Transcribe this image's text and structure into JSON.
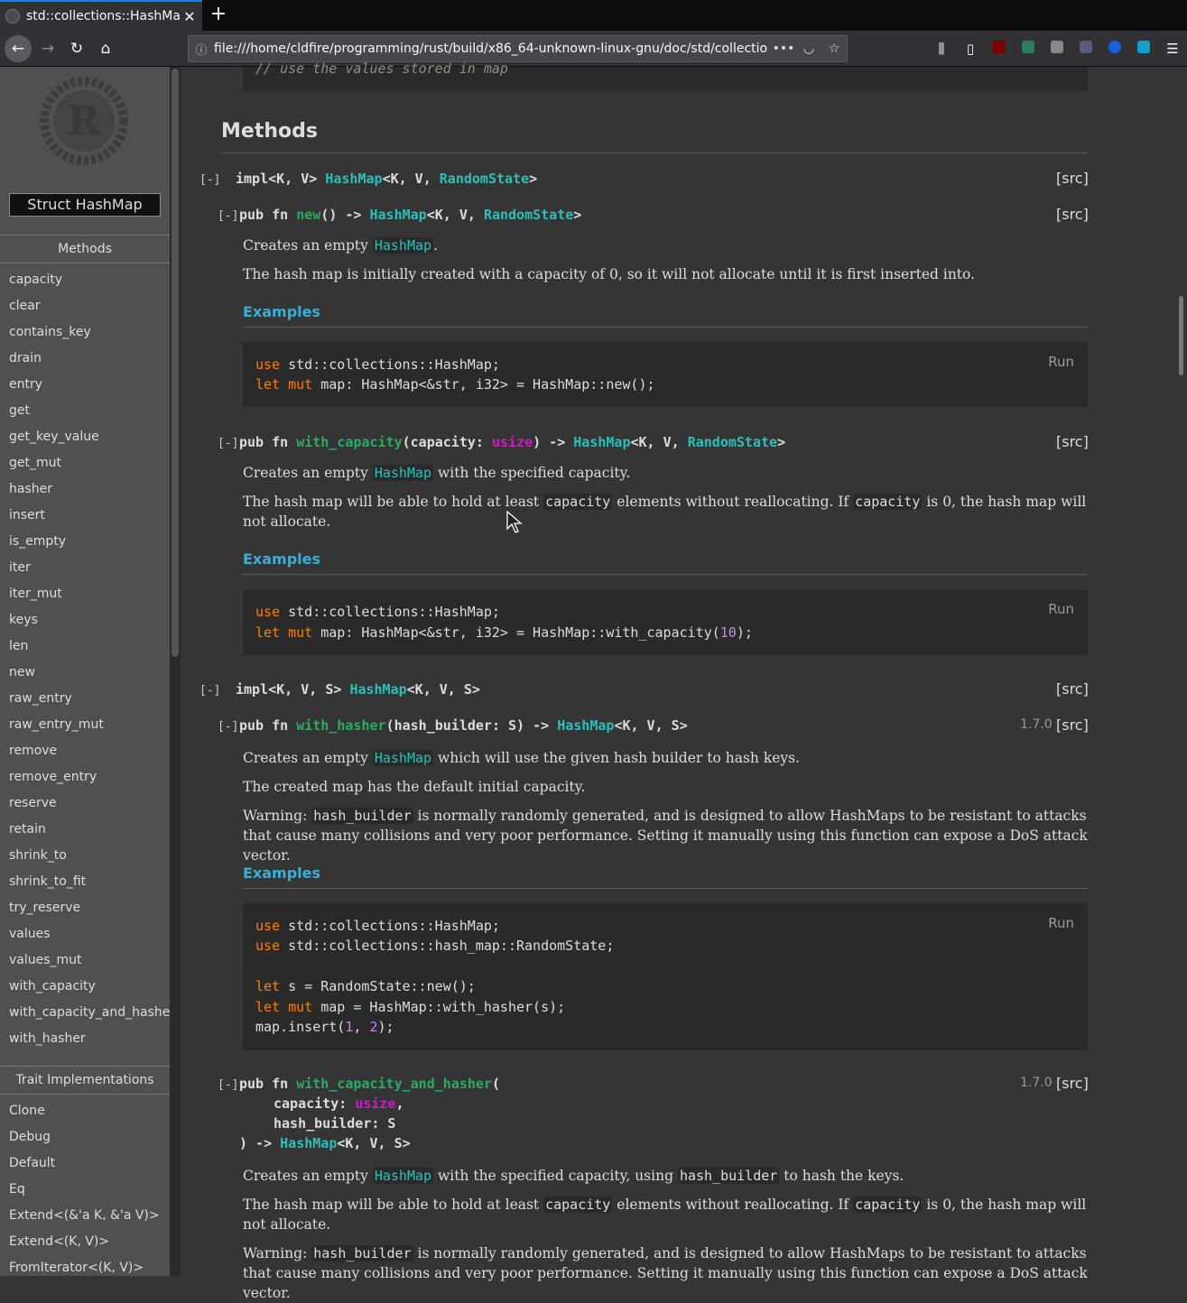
{
  "browser": {
    "tab_title": "std::collections::HashMa",
    "url": "file:///home/cldfire/programming/rust/build/x86_64-unknown-linux-gnu/doc/std/collectio",
    "more_label": "•••"
  },
  "sidebar": {
    "struct_title": "Struct HashMap",
    "methods_header": "Methods",
    "methods": [
      "capacity",
      "clear",
      "contains_key",
      "drain",
      "entry",
      "get",
      "get_key_value",
      "get_mut",
      "hasher",
      "insert",
      "is_empty",
      "iter",
      "iter_mut",
      "keys",
      "len",
      "new",
      "raw_entry",
      "raw_entry_mut",
      "remove",
      "remove_entry",
      "reserve",
      "retain",
      "shrink_to",
      "shrink_to_fit",
      "try_reserve",
      "values",
      "values_mut",
      "with_capacity",
      "with_capacity_and_hasher",
      "with_hasher"
    ],
    "trait_header": "Trait Implementations",
    "traits": [
      "Clone",
      "Debug",
      "Default",
      "Eq",
      "Extend<(&'a K, &'a V)>",
      "Extend<(K, V)>",
      "FromIterator<(K, V)>"
    ]
  },
  "content": {
    "top_comment": "// use the values stored in map",
    "methods_heading": "Methods",
    "toggle_label": "[-]",
    "src_label": "[src]",
    "run_label": "Run",
    "examples_label": "Examples",
    "impl1": {
      "a": "impl<K, V> ",
      "b": "HashMap",
      "c": "<K, V, ",
      "d": "RandomState",
      "e": ">"
    },
    "fn_new": {
      "sig": [
        "pub fn ",
        "new",
        "() -> ",
        "HashMap",
        "<K, V, ",
        "RandomState",
        ">"
      ],
      "p1": [
        "Creates an empty ",
        "HashMap",
        "."
      ],
      "p2": "The hash map is initially created with a capacity of 0, so it will not allocate until it is first inserted into.",
      "code": [
        "std::collections::HashMap;",
        "map: HashMap<&str, i32> = HashMap::new();"
      ]
    },
    "fn_with_capacity": {
      "sig": [
        "pub fn ",
        "with_capacity",
        "(capacity: ",
        "usize",
        ") -> ",
        "HashMap",
        "<K, V, ",
        "RandomState",
        ">"
      ],
      "p1": [
        "Creates an empty ",
        "HashMap",
        " with the specified capacity."
      ],
      "p2": [
        "The hash map will be able to hold at least ",
        "capacity",
        " elements without reallocating. If ",
        "capacity",
        " is 0, the hash map will not allocate."
      ],
      "code": [
        "std::collections::HashMap;",
        "map: HashMap<&str, i32> = HashMap::with_capacity(",
        "10",
        ");"
      ]
    },
    "impl2": {
      "a": "impl<K, V, S> ",
      "b": "HashMap",
      "c": "<K, V, S>"
    },
    "fn_with_hasher": {
      "version": "1.7.0",
      "sig": [
        "pub fn ",
        "with_hasher",
        "(hash_builder: S) -> ",
        "HashMap",
        "<K, V, S>"
      ],
      "p1": [
        "Creates an empty ",
        "HashMap",
        " which will use the given hash builder to hash keys."
      ],
      "p2": "The created map has the default initial capacity.",
      "p3": [
        "Warning: ",
        "hash_builder",
        " is normally randomly generated, and is designed to allow HashMaps to be resistant to attacks that cause many collisions and very poor performance. Setting it manually using this function can expose a DoS attack vector."
      ],
      "code": [
        "std::collections::HashMap;",
        "std::collections::hash_map::RandomState;",
        "s = RandomState::new();",
        "map = HashMap::with_hasher(s);",
        "map.insert(",
        "1",
        ", ",
        "2",
        ");"
      ]
    },
    "fn_with_capacity_and_hasher": {
      "version": "1.7.0",
      "sig": [
        "pub fn ",
        "with_capacity_and_hasher",
        "(",
        "capacity: ",
        "usize",
        ",",
        "hash_builder: S",
        ") -> ",
        "HashMap",
        "<K, V, S>"
      ],
      "p1": [
        "Creates an empty ",
        "HashMap",
        " with the specified capacity, using ",
        "hash_builder",
        " to hash the keys."
      ],
      "p2": [
        "The hash map will be able to hold at least ",
        "capacity",
        " elements without reallocating. If ",
        "capacity",
        " is 0, the hash map will not allocate."
      ],
      "p3": [
        "Warning: ",
        "hash_builder",
        " is normally randomly generated, and is designed to allow HashMaps to be resistant to attacks that cause many collisions and very poor performance. Setting it manually using this function can expose a DoS attack vector."
      ]
    },
    "kw_use": "use",
    "kw_let": "let",
    "kw_mut": "mut"
  },
  "colors": {
    "background": "#353535",
    "sidebar": "#505050",
    "code_bg": "#2a2a2a",
    "function": "#2bab63",
    "type": "#2dbfb8",
    "primitive": "#ce1ac4",
    "examples_link": "#39afd7"
  },
  "icons": [
    "back-arrow-icon",
    "forward-arrow-icon",
    "reload-icon",
    "home-icon",
    "info-icon",
    "pocket-icon",
    "bookmark-star-icon",
    "library-icon",
    "sidebar-icon",
    "ublock-icon",
    "stylus-icon",
    "menu-icon"
  ]
}
